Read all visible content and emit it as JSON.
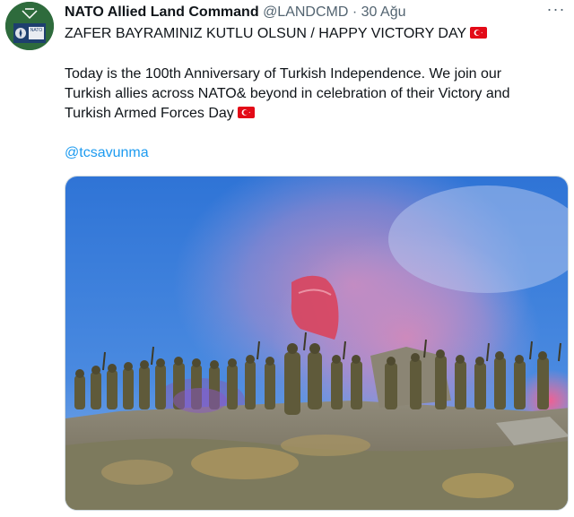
{
  "tweet": {
    "author_name": "NATO Allied Land Command",
    "handle": "@LANDCMD",
    "separator": "·",
    "date": "30 Ağu",
    "more_label": "···",
    "headline": "ZAFER BAYRAMINIZ KUTLU OLSUN / HAPPY VICTORY DAY",
    "body": "Today is the 100th Anniversary of Turkish Independence. We join our Turkish allies across NATO& beyond in celebration of their Victory and Turkish Armed Forces Day",
    "mention": "@tcsavunma",
    "flag_icon": "turkey-flag-icon",
    "avatar_text": "NATO"
  },
  "colors": {
    "accent": "#1d9bf0",
    "secondary_text": "#536471",
    "flag_red": "#e30a17",
    "avatar_green": "#2e6b3c"
  }
}
